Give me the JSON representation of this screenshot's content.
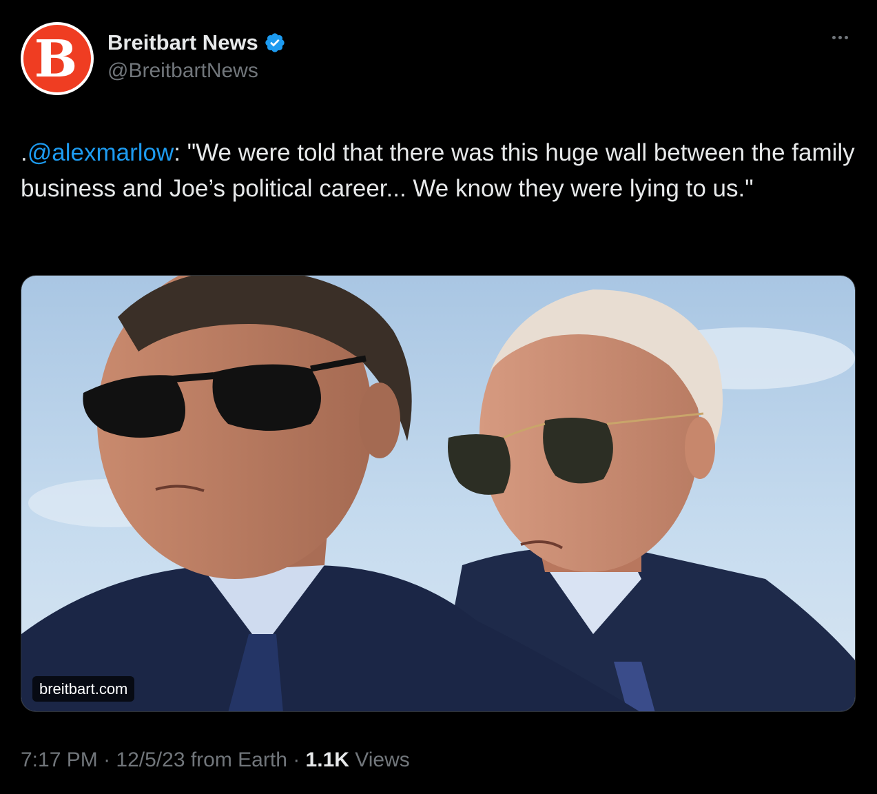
{
  "author": {
    "display_name": "Breitbart News",
    "handle": "@BreitbartNews",
    "avatar_letter": "B",
    "avatar_color": "#ef3d22",
    "verified": true,
    "verified_color": "#1d9bf0"
  },
  "more_icon": "more-horizontal-icon",
  "tweet": {
    "prefix": ".",
    "mention": "@alexmarlow",
    "body": ": \"We were told that there was this huge wall between the family business and Joe’s political career... We know they were lying to us.\""
  },
  "media": {
    "source_label": "breitbart.com"
  },
  "meta": {
    "time": "7:17 PM",
    "sep1": " · ",
    "date": "12/5/23",
    "location": " from Earth",
    "sep2": " · ",
    "views_count": "1.1K",
    "views_label": " Views"
  },
  "colors": {
    "background": "#000000",
    "primary_text": "#e7e9ea",
    "secondary_text": "#71767b",
    "link": "#1d9bf0"
  }
}
